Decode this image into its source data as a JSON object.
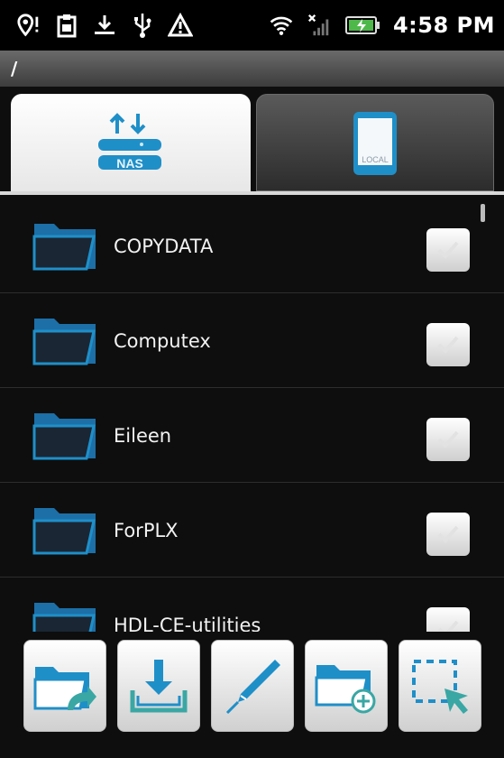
{
  "status_bar": {
    "time": "4:58 PM",
    "icons": [
      "location-alert-icon",
      "clipboard-icon",
      "download-icon",
      "usb-icon",
      "warning-icon",
      "wifi-icon",
      "no-signal-icon",
      "battery-charging-icon"
    ]
  },
  "path": "/",
  "tabs": [
    {
      "id": "nas",
      "label": "NAS",
      "selected": true
    },
    {
      "id": "local",
      "label": "LOCAL",
      "selected": false
    }
  ],
  "folders": [
    {
      "name": "COPYDATA"
    },
    {
      "name": "Computex"
    },
    {
      "name": "Eileen"
    },
    {
      "name": "ForPLX"
    },
    {
      "name": "HDL-CE-utilities"
    }
  ],
  "toolbar": [
    {
      "id": "move",
      "icon": "move-folder-icon"
    },
    {
      "id": "download",
      "icon": "download-tray-icon"
    },
    {
      "id": "rename",
      "icon": "pen-icon"
    },
    {
      "id": "new-folder",
      "icon": "add-folder-icon"
    },
    {
      "id": "select",
      "icon": "select-area-icon"
    }
  ],
  "colors": {
    "accent_blue": "#1f8fc8",
    "teal": "#3aa7a4",
    "background": "#0e0e0e"
  }
}
